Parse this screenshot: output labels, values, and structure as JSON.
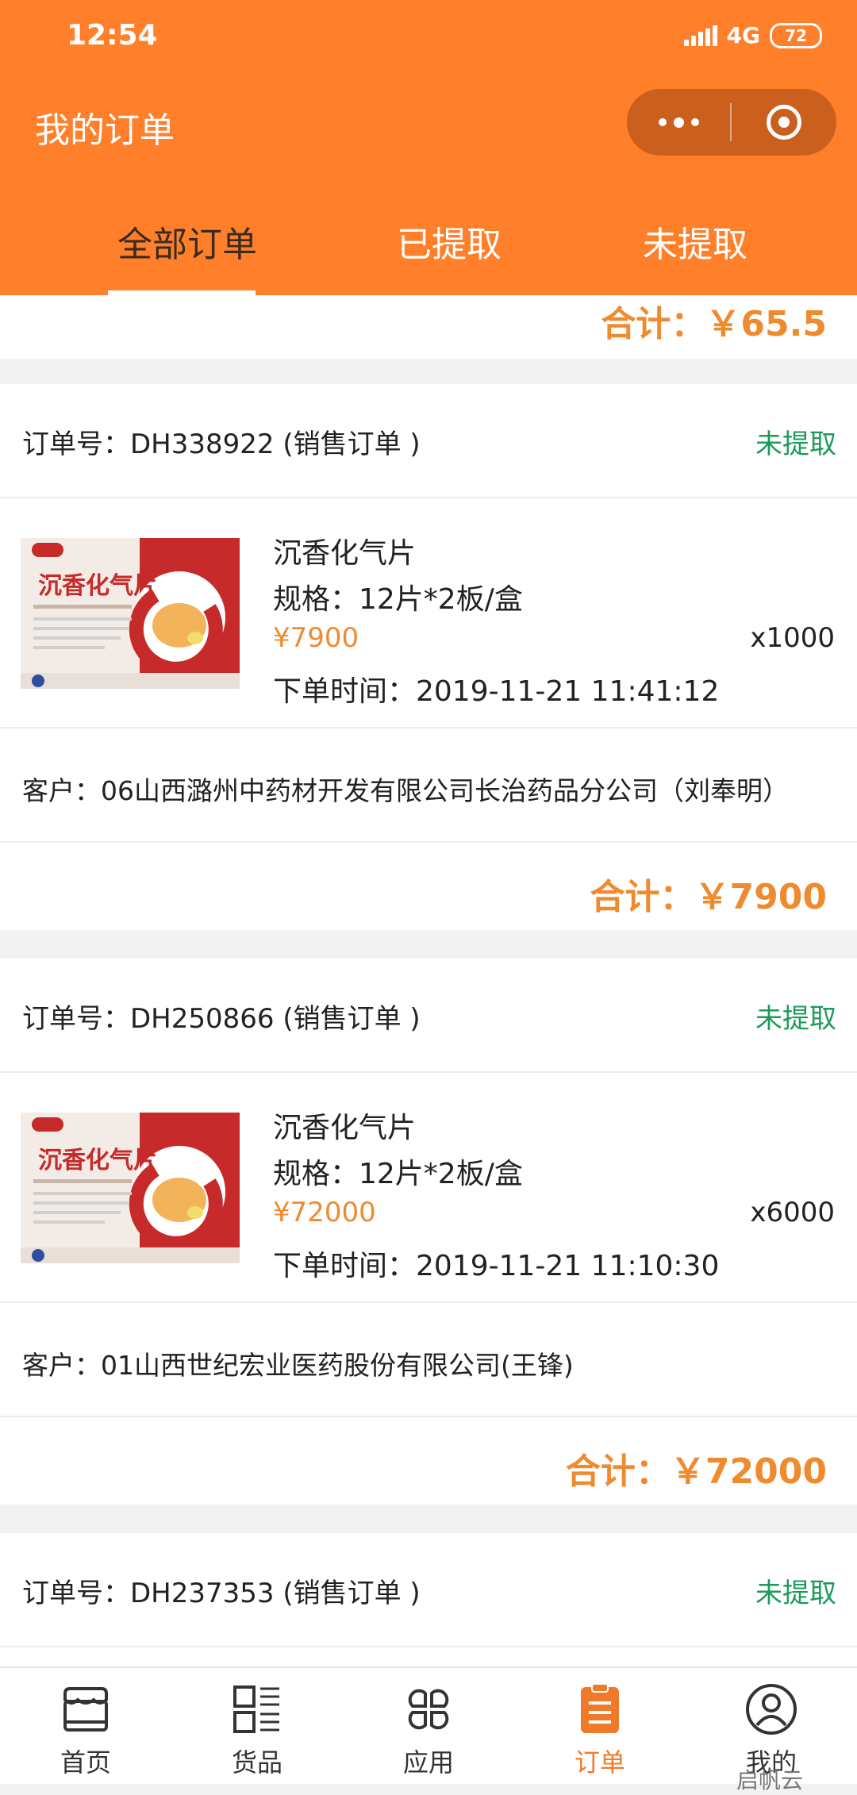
{
  "status_bar": {
    "time": "12:54",
    "network": "4G",
    "battery": "72"
  },
  "header": {
    "title": "我的订单"
  },
  "tabs": [
    {
      "label": "全部订单",
      "active": true
    },
    {
      "label": "已提取",
      "active": false
    },
    {
      "label": "未提取",
      "active": false
    }
  ],
  "top_partial": {
    "total": "合计：￥65.5"
  },
  "orders": [
    {
      "header": "订单号：DH338922 (销售订单 )",
      "status": "未提取",
      "product": {
        "name": "沉香化气片",
        "spec": "规格：12片*2板/盒",
        "price": "¥7900",
        "qty": "x1000",
        "time": "下单时间：2019-11-21 11:41:12"
      },
      "customer": "客户：06山西潞州中药材开发有限公司长治药品分公司（刘奉明）",
      "total": "合计：￥7900"
    },
    {
      "header": "订单号：DH250866 (销售订单 )",
      "status": "未提取",
      "product": {
        "name": "沉香化气片",
        "spec": "规格：12片*2板/盒",
        "price": "¥72000",
        "qty": "x6000",
        "time": "下单时间：2019-11-21 11:10:30"
      },
      "customer": "客户：01山西世纪宏业医药股份有限公司(王锋)",
      "total": "合计：￥72000"
    },
    {
      "header": "订单号：DH237353 (销售订单 )",
      "status": "未提取"
    }
  ],
  "tabbar": [
    {
      "label": "首页",
      "icon": "store-icon",
      "active": false
    },
    {
      "label": "货品",
      "icon": "goods-list-icon",
      "active": false
    },
    {
      "label": "应用",
      "icon": "apps-icon",
      "active": false
    },
    {
      "label": "订单",
      "icon": "order-icon",
      "active": true
    },
    {
      "label": "我的",
      "icon": "user-icon",
      "active": false
    }
  ],
  "watermark": "启帆云",
  "colors": {
    "brand": "#ff7f2a",
    "status_green": "#1c9a5c",
    "price_orange": "#f08a2e"
  }
}
